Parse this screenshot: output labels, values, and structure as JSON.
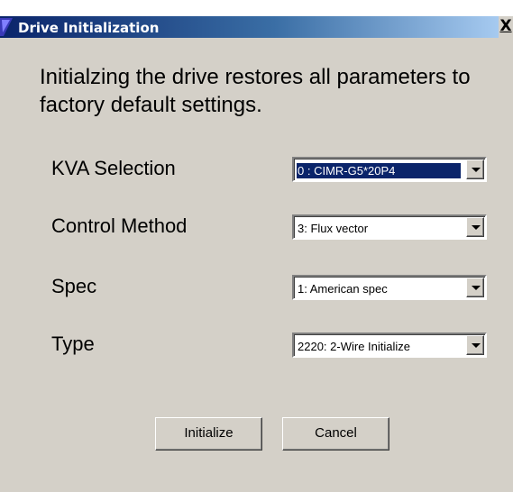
{
  "window": {
    "title": "Drive Initialization",
    "close_glyph": "X"
  },
  "message": "Initialzing the drive restores all parameters to factory default settings.",
  "fields": [
    {
      "label": "KVA Selection",
      "value": "0 : CIMR-G5*20P4",
      "focused": true
    },
    {
      "label": "Control Method",
      "value": "3: Flux vector",
      "focused": false
    },
    {
      "label": "Spec",
      "value": "1: American spec",
      "focused": false
    },
    {
      "label": "Type",
      "value": "2220: 2-Wire Initialize",
      "focused": false
    }
  ],
  "buttons": {
    "initialize": "Initialize",
    "cancel": "Cancel"
  },
  "colors": {
    "face": "#d4d0c8",
    "title_start": "#0a246a",
    "title_end": "#a6caf0",
    "selection": "#0a246a"
  }
}
